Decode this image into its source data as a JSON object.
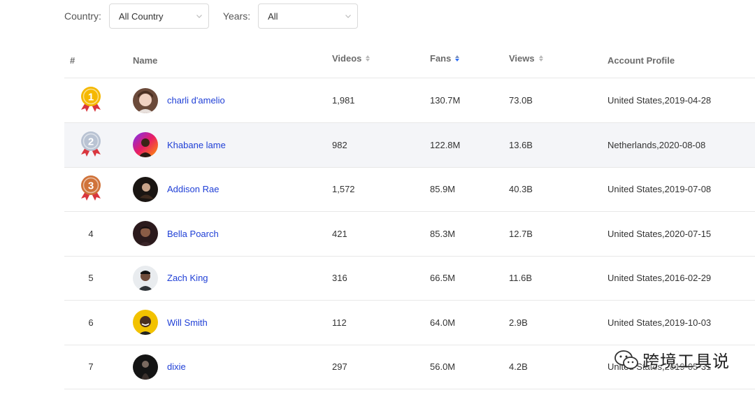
{
  "filters": {
    "country": {
      "label": "Country:",
      "value": "All Country"
    },
    "years": {
      "label": "Years:",
      "value": "All"
    }
  },
  "table": {
    "columns": {
      "rank": "#",
      "name": "Name",
      "videos": "Videos",
      "fans": "Fans",
      "views": "Views",
      "profile": "Account Profile"
    },
    "sorted_by": "Fans",
    "rows": [
      {
        "rank": "1",
        "medal": "gold",
        "name": "charli d'amelio",
        "videos": "1,981",
        "fans": "130.7M",
        "views": "73.0B",
        "profile": "United States,2019-04-28"
      },
      {
        "rank": "2",
        "medal": "silver",
        "name": "Khabane lame",
        "videos": "982",
        "fans": "122.8M",
        "views": "13.6B",
        "profile": "Netherlands,2020-08-08"
      },
      {
        "rank": "3",
        "medal": "bronze",
        "name": "Addison Rae",
        "videos": "1,572",
        "fans": "85.9M",
        "views": "40.3B",
        "profile": "United States,2019-07-08"
      },
      {
        "rank": "4",
        "name": "Bella Poarch",
        "videos": "421",
        "fans": "85.3M",
        "views": "12.7B",
        "profile": "United States,2020-07-15"
      },
      {
        "rank": "5",
        "name": "Zach King",
        "videos": "316",
        "fans": "66.5M",
        "views": "11.6B",
        "profile": "United States,2016-02-29"
      },
      {
        "rank": "6",
        "name": "Will Smith",
        "videos": "112",
        "fans": "64.0M",
        "views": "2.9B",
        "profile": "United States,2019-10-03"
      },
      {
        "rank": "7",
        "name": "dixie",
        "videos": "297",
        "fans": "56.0M",
        "views": "4.2B",
        "profile": "United States,2019-05-31"
      }
    ]
  },
  "colors": {
    "gold": "#f5b800",
    "silver": "#b9c3d3",
    "bronze": "#d0733a",
    "ribbon": "#d9363e",
    "link": "#1f3fd6",
    "sort_active": "#2d6ff7"
  },
  "watermark": {
    "text": "跨境工具说",
    "icon": "wechat-icon"
  }
}
